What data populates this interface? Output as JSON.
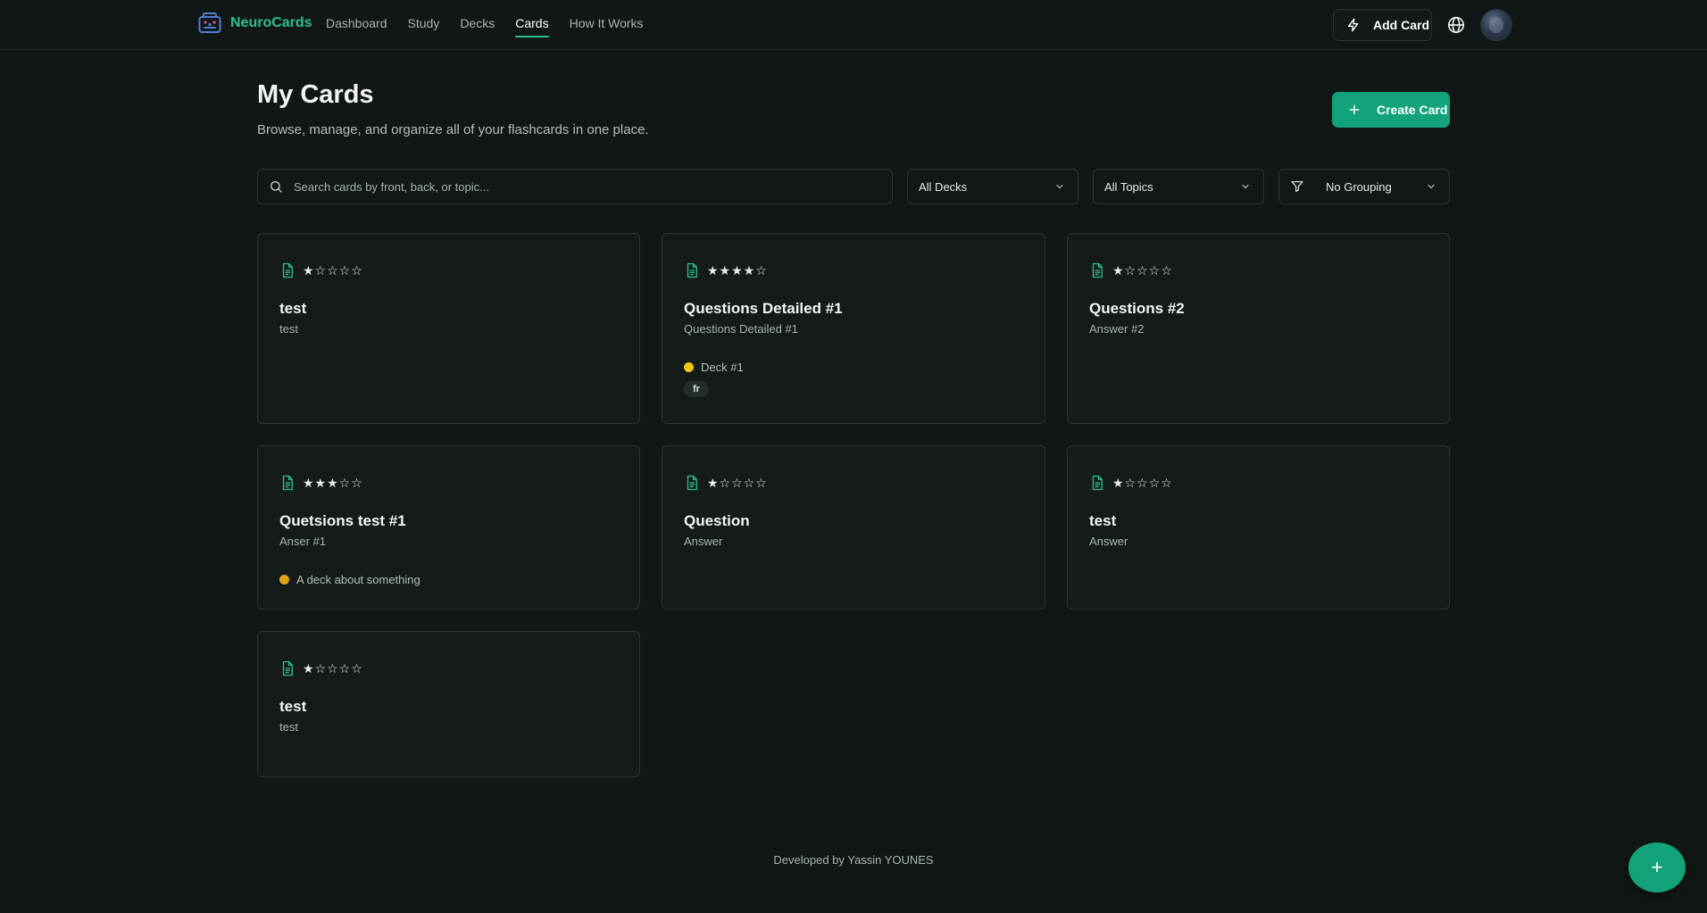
{
  "colors": {
    "accent": "#12a37b",
    "brand": "#2fbf8f",
    "background": "#111716"
  },
  "brand": {
    "name": "NeuroCards"
  },
  "nav": [
    {
      "label": "Dashboard",
      "active": false
    },
    {
      "label": "Study",
      "active": false
    },
    {
      "label": "Decks",
      "active": false
    },
    {
      "label": "Cards",
      "active": true
    },
    {
      "label": "How It Works",
      "active": false
    }
  ],
  "header": {
    "add_card_label": "Add Card"
  },
  "page": {
    "title": "My Cards",
    "subtitle": "Browse, manage, and organize all of your flashcards in one place.",
    "create_label": "Create Card"
  },
  "filters": {
    "search_placeholder": "Search cards by front, back, or topic...",
    "decks": "All Decks",
    "topics": "All Topics",
    "grouping": "No Grouping"
  },
  "cards": [
    {
      "stars": "★☆☆☆☆",
      "front": "test",
      "back": "test"
    },
    {
      "stars": "★★★★☆",
      "front": "Questions Detailed #1",
      "back": "Questions Detailed #1",
      "deck": "Deck #1",
      "deck_color": "#f2c618",
      "tag": "fr"
    },
    {
      "stars": "★☆☆☆☆",
      "front": "Questions #2",
      "back": "Answer #2"
    },
    {
      "stars": "★★★☆☆",
      "front": "Quetsions test #1",
      "back": "Anser #1",
      "deck": "A deck about something",
      "deck_color": "#e0a21a"
    },
    {
      "stars": "★☆☆☆☆",
      "front": "Question",
      "back": "Answer"
    },
    {
      "stars": "★☆☆☆☆",
      "front": "test",
      "back": "Answer"
    },
    {
      "stars": "★☆☆☆☆",
      "front": "test",
      "back": "test"
    }
  ],
  "footer": {
    "text": "Developed by Yassin YOUNES"
  },
  "fab": {
    "label": "+"
  }
}
